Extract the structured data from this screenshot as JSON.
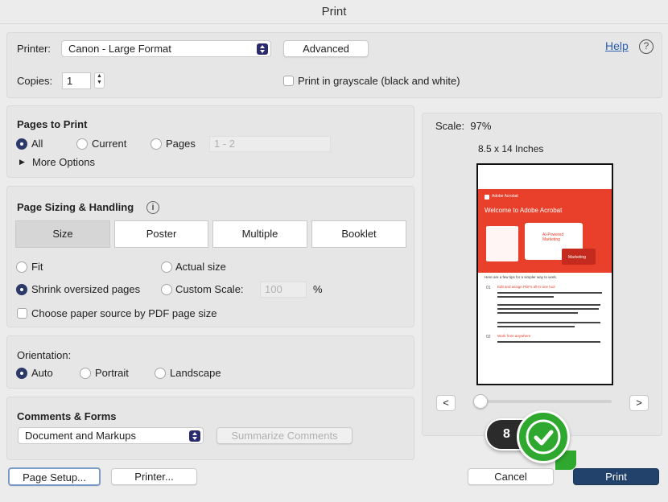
{
  "window": {
    "title": "Print"
  },
  "printer": {
    "label": "Printer:",
    "selected": "Canon - Large Format",
    "advanced_label": "Advanced",
    "help_label": "Help",
    "help_icon": "?",
    "copies_label": "Copies:",
    "copies_value": "1",
    "grayscale_label": "Print in grayscale (black and white)"
  },
  "pages_to_print": {
    "title": "Pages to Print",
    "options": [
      "All",
      "Current",
      "Pages"
    ],
    "selected": "All",
    "range_placeholder": "1 - 2",
    "more_options_label": "More Options"
  },
  "page_sizing": {
    "title": "Page Sizing & Handling",
    "info_icon": "i",
    "tabs": [
      "Size",
      "Poster",
      "Multiple",
      "Booklet"
    ],
    "active_tab": "Size",
    "fit_label": "Fit",
    "actual_size_label": "Actual size",
    "shrink_label": "Shrink oversized pages",
    "custom_scale_label": "Custom Scale:",
    "custom_scale_placeholder": "100",
    "percent_sign": "%",
    "paper_source_label": "Choose paper source by PDF page size"
  },
  "orientation": {
    "title": "Orientation:",
    "options": [
      "Auto",
      "Portrait",
      "Landscape"
    ],
    "selected": "Auto"
  },
  "comments_forms": {
    "title": "Comments & Forms",
    "selected": "Document and Markups",
    "summarize_label": "Summarize Comments"
  },
  "preview": {
    "scale_text": "Scale:  97%",
    "paper_size": "8.5 x 14 Inches",
    "prev_label": "<",
    "next_label": ">",
    "doc_brand": "Adobe Acrobat",
    "doc_heading": "Welcome to Adobe Acrobat",
    "doc_card_label": "AI-Powered Marketing",
    "doc_sub_label": "Marketing",
    "doc_intro": "Here are a few tips for a simpler way to work.",
    "doc_section1": "Edit and assign PDFs all-in-one tool",
    "doc_section2": "Work from anywhere",
    "doc_num1": "01",
    "doc_num2": "02"
  },
  "badge": {
    "number": "8"
  },
  "footer": {
    "page_setup_label": "Page Setup...",
    "printer_label": "Printer...",
    "cancel_label": "Cancel",
    "print_label": "Print"
  },
  "colors": {
    "accent": "#2c3a6b",
    "print_button": "#23426b",
    "link": "#2a5db0",
    "acrobat_red": "#e8402a",
    "badge_dark": "#2b2b2b",
    "check_green": "#2ea82e"
  }
}
